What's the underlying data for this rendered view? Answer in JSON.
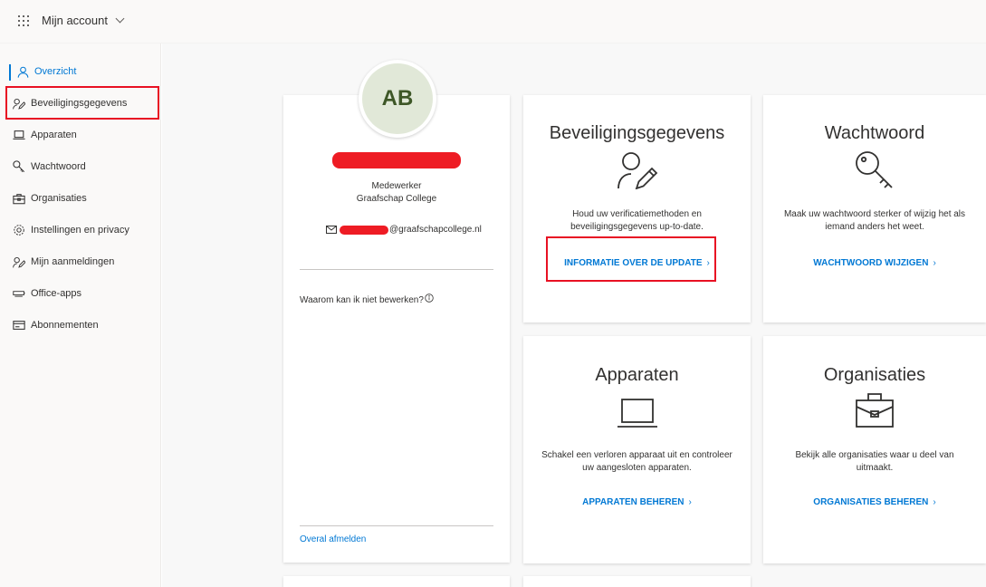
{
  "header": {
    "title": "Mijn account"
  },
  "sidebar": {
    "items": [
      {
        "label": "Overzicht",
        "icon": "person-icon"
      },
      {
        "label": "Beveiligingsgegevens",
        "icon": "person-edit-icon"
      },
      {
        "label": "Apparaten",
        "icon": "laptop-icon"
      },
      {
        "label": "Wachtwoord",
        "icon": "key-icon"
      },
      {
        "label": "Organisaties",
        "icon": "briefcase-icon"
      },
      {
        "label": "Instellingen en privacy",
        "icon": "gear-icon"
      },
      {
        "label": "Mijn aanmeldingen",
        "icon": "person-edit-icon"
      },
      {
        "label": "Office-apps",
        "icon": "office-apps-icon"
      },
      {
        "label": "Abonnementen",
        "icon": "subscriptions-icon"
      }
    ]
  },
  "profile": {
    "initials": "AB",
    "role": "Medewerker",
    "organization": "Graafschap College",
    "email_domain": "@graafschapcollege.nl",
    "why_text": "Waarom kan ik niet bewerken?",
    "sign_out_everywhere": "Overal afmelden"
  },
  "tiles": {
    "security": {
      "title": "Beveiligingsgegevens",
      "description": "Houd uw verificatiemethoden en beveiligingsgegevens up-to-date.",
      "link": "INFORMATIE OVER DE UPDATE"
    },
    "password": {
      "title": "Wachtwoord",
      "description": "Maak uw wachtwoord sterker of wijzig het als iemand anders het weet.",
      "link": "WACHTWOORD WIJZIGEN"
    },
    "devices": {
      "title": "Apparaten",
      "description": "Schakel een verloren apparaat uit en controleer uw aangesloten apparaten.",
      "link": "APPARATEN BEHEREN"
    },
    "organizations": {
      "title": "Organisaties",
      "description": "Bekijk alle organisaties waar u deel van uitmaakt.",
      "link": "ORGANISATIES BEHEREN"
    }
  },
  "colors": {
    "accent": "#0078d4",
    "highlight": "#e81123",
    "redaction": "#ee1c24",
    "avatar_bg": "#e1e8d8"
  }
}
